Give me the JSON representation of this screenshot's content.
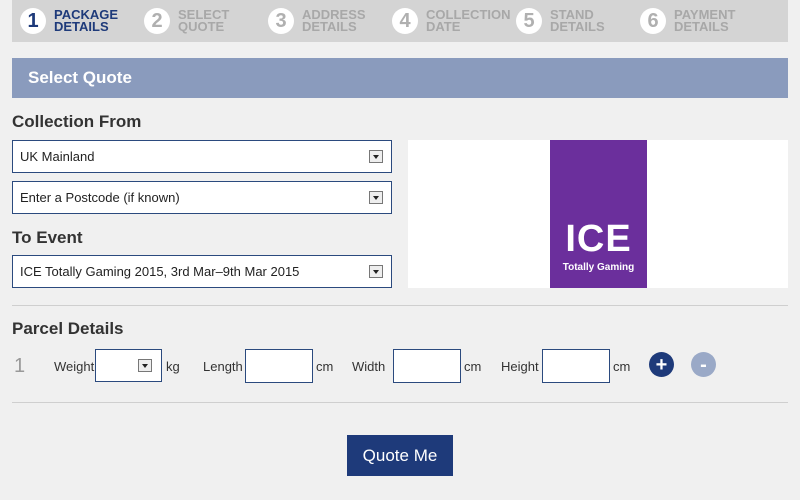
{
  "steps": [
    {
      "num": "1",
      "label": "PACKAGE DETAILS",
      "active": true
    },
    {
      "num": "2",
      "label": "SELECT QUOTE",
      "active": false
    },
    {
      "num": "3",
      "label": "ADDRESS DETAILS",
      "active": false
    },
    {
      "num": "4",
      "label": "COLLECTION DATE",
      "active": false
    },
    {
      "num": "5",
      "label": "STAND DETAILS",
      "active": false
    },
    {
      "num": "6",
      "label": "PAYMENT DETAILS",
      "active": false
    }
  ],
  "section": {
    "title": "Select Quote"
  },
  "collection": {
    "heading": "Collection From",
    "region_value": "UK Mainland",
    "postcode_value": "Enter a Postcode (if known)"
  },
  "event": {
    "heading": "To Event",
    "value": "ICE Totally Gaming 2015, 3rd Mar–9th Mar 2015"
  },
  "logo": {
    "main": "ICE",
    "sub": "Totally Gaming",
    "bg_color": "#6b2f9c"
  },
  "parcel": {
    "heading": "Parcel Details",
    "index": "1",
    "weight_label": "Weight",
    "weight_unit": "kg",
    "length_label": "Length",
    "length_unit": "cm",
    "width_label": "Width",
    "width_unit": "cm",
    "height_label": "Height",
    "height_unit": "cm",
    "add_symbol": "+",
    "remove_symbol": "-"
  },
  "actions": {
    "quote_label": "Quote Me"
  },
  "colors": {
    "accent": "#1e3a7a",
    "header_bg": "#8a9bbd",
    "steps_bg": "#d4d4d4"
  }
}
